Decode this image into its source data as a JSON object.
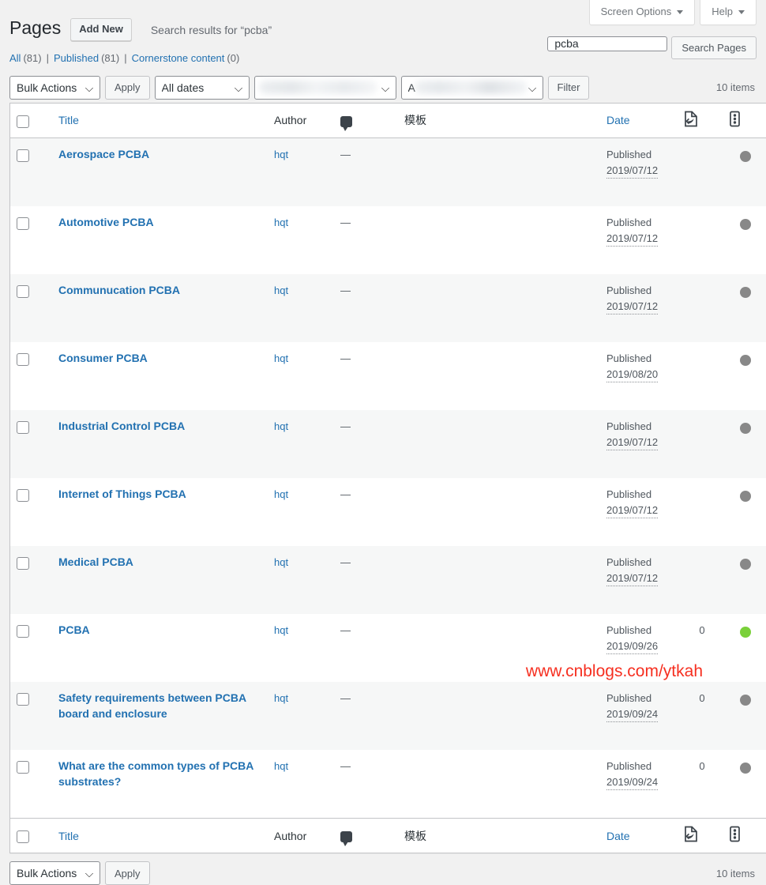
{
  "screen_meta": {
    "screen_options_label": "Screen Options",
    "help_label": "Help"
  },
  "header": {
    "title": "Pages",
    "add_new_label": "Add New",
    "subtitle": "Search results for “pcba”"
  },
  "search": {
    "value": "pcba",
    "placeholder": "",
    "submit_label": "Search Pages"
  },
  "views": [
    {
      "label": "All",
      "count": "(81)"
    },
    {
      "label": "Published",
      "count": "(81)"
    },
    {
      "label": "Cornerstone content",
      "count": "(0)"
    }
  ],
  "separator": "|",
  "tablenav_top": {
    "bulk_actions_selected": "Bulk Actions",
    "apply_label": "Apply",
    "dates_selected": "All dates",
    "redacted_filter_1": "",
    "redacted_filter_2": "A",
    "filter_label": "Filter",
    "displaying_num": "10 items"
  },
  "tablenav_bottom": {
    "bulk_actions_selected": "Bulk Actions",
    "apply_label": "Apply",
    "displaying_num": "10 items"
  },
  "columns": {
    "title": "Title",
    "author": "Author",
    "comments_icon": "comment-bubble-icon",
    "template": "模板",
    "date": "Date",
    "yoast_seo_icon": "seo-score-icon",
    "yoast_readability_icon": "readability-score-icon",
    "yoast_keyphrase_icon": "keyphrase-feather-icon"
  },
  "rows": [
    {
      "title": "Aerospace PCBA",
      "author": "hqt",
      "comments": "—",
      "template": "",
      "status": "Published",
      "date": "2019/07/12",
      "seo_score_color": "#888888",
      "readability_score_color": "#888888"
    },
    {
      "title": "Automotive PCBA",
      "author": "hqt",
      "comments": "—",
      "template": "",
      "status": "Published",
      "date": "2019/07/12",
      "seo_score_color": "#888888",
      "readability_score_color": "#888888"
    },
    {
      "title": "Communucation PCBA",
      "author": "hqt",
      "comments": "—",
      "template": "",
      "status": "Published",
      "date": "2019/07/12",
      "seo_score_color": "#888888",
      "readability_score_color": "#888888"
    },
    {
      "title": "Consumer PCBA",
      "author": "hqt",
      "comments": "—",
      "template": "",
      "status": "Published",
      "date": "2019/08/20",
      "seo_score_color": "#888888",
      "readability_score_color": "#888888"
    },
    {
      "title": "Industrial Control PCBA",
      "author": "hqt",
      "comments": "—",
      "template": "",
      "status": "Published",
      "date": "2019/07/12",
      "seo_score_color": "#888888",
      "readability_score_color": "#888888"
    },
    {
      "title": "Internet of Things PCBA",
      "author": "hqt",
      "comments": "—",
      "template": "",
      "status": "Published",
      "date": "2019/07/12",
      "seo_score_color": "#888888",
      "readability_score_color": "#888888"
    },
    {
      "title": "Medical PCBA",
      "author": "hqt",
      "comments": "—",
      "template": "",
      "status": "Published",
      "date": "2019/07/12",
      "seo_score_color": "#888888",
      "readability_score_color": "#888888"
    },
    {
      "title": "PCBA",
      "author": "hqt",
      "comments": "—",
      "template": "",
      "status": "Published",
      "date": "2019/09/26",
      "comment_count": "0",
      "seo_score_color": "#7ad03a",
      "readability_score_color": "#ee7c1b"
    },
    {
      "title": "Safety requirements between PCBA board and enclosure",
      "author": "hqt",
      "comments": "—",
      "template": "",
      "status": "Published",
      "date": "2019/09/24",
      "comment_count": "0",
      "seo_score_color": "#888888",
      "readability_score_color": "#dc3232"
    },
    {
      "title": "What are the common types of PCBA substrates?",
      "author": "hqt",
      "comments": "—",
      "template": "",
      "status": "Published",
      "date": "2019/09/24",
      "comment_count": "0",
      "seo_score_color": "#888888",
      "readability_score_color": "#dc3232"
    }
  ],
  "watermark": "www.cnblogs.com/ytkah",
  "colors": {
    "link": "#2271b1",
    "good": "#7ad03a",
    "ok": "#ee7c1b",
    "bad": "#dc3232",
    "na": "#888888",
    "watermark": "#f62f20"
  }
}
